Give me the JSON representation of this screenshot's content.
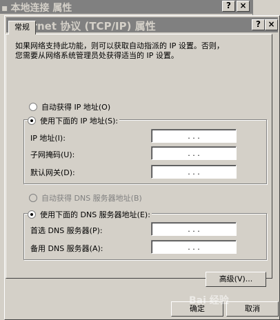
{
  "background_window": {
    "title": "本地连接 属性",
    "help_button": "?",
    "close_button": "×"
  },
  "dialog": {
    "title": "Internet 协议 (TCP/IP) 属性",
    "help_button": "?",
    "close_button": "×"
  },
  "tab": {
    "label": "常规"
  },
  "description": {
    "line1": "如果网络支持此功能，则可以获取自动指派的 IP 设置。否则，",
    "line2": "您需要从网络系统管理员处获得适当的 IP 设置。"
  },
  "ip_section": {
    "auto_label": "自动获得 IP 地址(O)",
    "manual_label": "使用下面的 IP 地址(S):",
    "selected": "manual",
    "fields": [
      {
        "label": "IP 地址(I):",
        "value": ". . ."
      },
      {
        "label": "子网掩码(U):",
        "value": ". . ."
      },
      {
        "label": "默认网关(D):",
        "value": ". . ."
      }
    ]
  },
  "dns_section": {
    "auto_label": "自动获得 DNS 服务器地址(B)",
    "manual_label": "使用下面的 DNS 服务器地址(E):",
    "selected": "manual",
    "fields": [
      {
        "label": "首选 DNS 服务器(P):",
        "value": ". . ."
      },
      {
        "label": "备用 DNS 服务器(A):",
        "value": ". . ."
      }
    ]
  },
  "buttons": {
    "advanced": "高级(V)...",
    "ok": "确定",
    "cancel": "取消"
  },
  "watermark": "Bai 经验"
}
